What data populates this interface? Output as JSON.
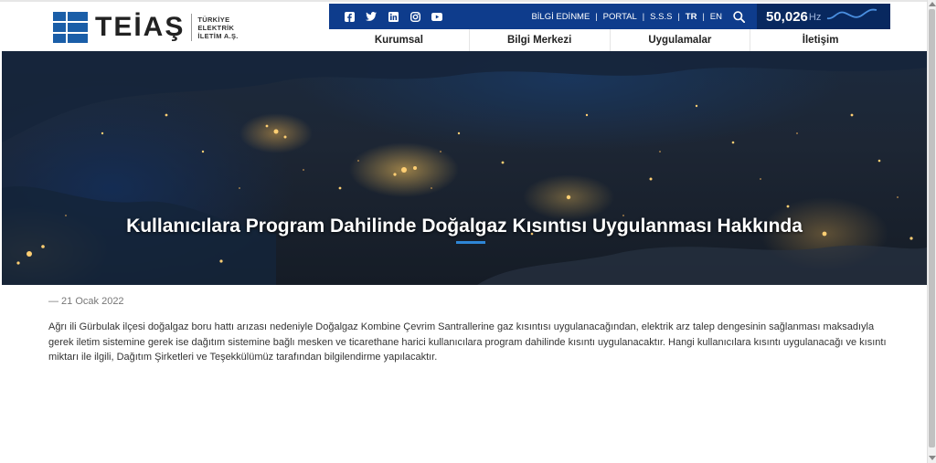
{
  "brand": {
    "name": "TEİAŞ",
    "sub_line1": "TÜRKİYE",
    "sub_line2": "ELEKTRİK",
    "sub_line3": "İLETİM A.Ş.",
    "primary_color": "#0e3c8c",
    "logo_color": "#1a5ea8"
  },
  "social": [
    "facebook-icon",
    "twitter-icon",
    "linkedin-icon",
    "instagram-icon",
    "youtube-icon"
  ],
  "toplinks": {
    "bilgi_edinme": "BİLGİ EDİNME",
    "portal": "PORTAL",
    "sss": "S.S.S",
    "tr": "TR",
    "en": "EN",
    "separator": "|"
  },
  "frequency": {
    "value": "50,026",
    "unit": "Hz"
  },
  "nav": {
    "kurumsal": "Kurumsal",
    "bilgi_merkezi": "Bilgi Merkezi",
    "uygulamalar": "Uygulamalar",
    "iletisim": "İletişim"
  },
  "article": {
    "title": "Kullanıcılara Program Dahilinde Doğalgaz Kısıntısı Uygulanması Hakkında",
    "date": "— 21 Ocak 2022",
    "body": "Ağrı ili Gürbulak ilçesi doğalgaz boru hattı arızası nedeniyle Doğalgaz Kombine Çevrim Santrallerine gaz kısıntısı uygulanacağından, elektrik arz talep dengesinin sağlanması maksadıyla gerek iletim sistemine gerek ise dağıtım sistemine bağlı mesken ve ticarethane harici kullanıcılara program dahilinde kısıntı uygulanacaktır. Hangi kullanıcılara kısıntı uygulanacağı ve kısıntı miktarı ile ilgili, Dağıtım Şirketleri ve Teşekkülümüz tarafından bilgilendirme yapılacaktır."
  }
}
